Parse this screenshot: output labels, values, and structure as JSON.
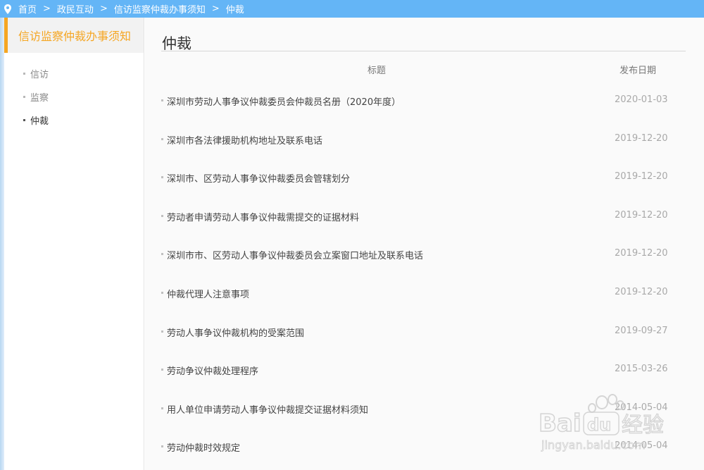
{
  "breadcrumb": {
    "items": [
      "首页",
      "政民互动",
      "信访监察仲裁办事须知",
      "仲裁"
    ],
    "separator": ">"
  },
  "sidebar": {
    "title": "信访监察仲裁办事须知",
    "items": [
      {
        "label": "信访"
      },
      {
        "label": "监察"
      },
      {
        "label": "仲裁",
        "active": true
      }
    ]
  },
  "main": {
    "title": "仲裁",
    "columns": {
      "title": "标题",
      "date": "发布日期"
    },
    "rows": [
      {
        "title": "深圳市劳动人事争议仲裁委员会仲裁员名册（2020年度）",
        "date": "2020-01-03"
      },
      {
        "title": "深圳市各法律援助机构地址及联系电话",
        "date": "2019-12-20"
      },
      {
        "title": "深圳市、区劳动人事争议仲裁委员会管辖划分",
        "date": "2019-12-20"
      },
      {
        "title": "劳动者申请劳动人事争议仲裁需提交的证据材料",
        "date": "2019-12-20"
      },
      {
        "title": "深圳市市、区劳动人事争议仲裁委员会立案窗口地址及联系电话",
        "date": "2019-12-20"
      },
      {
        "title": "仲裁代理人注意事项",
        "date": "2019-12-20"
      },
      {
        "title": "劳动人事争议仲裁机构的受案范围",
        "date": "2019-09-27"
      },
      {
        "title": "劳动争议仲裁处理程序",
        "date": "2015-03-26"
      },
      {
        "title": "用人单位申请劳动人事争议仲裁提交证据材料须知",
        "date": "2014-05-04"
      },
      {
        "title": "劳动仲裁时效规定",
        "date": "2014-05-04"
      }
    ]
  },
  "watermark": {
    "brand": "Bai du 经验",
    "url": "jingyan.baidu.com"
  },
  "colors": {
    "topbar": "#64b5f6",
    "accent": "#f5a623"
  }
}
